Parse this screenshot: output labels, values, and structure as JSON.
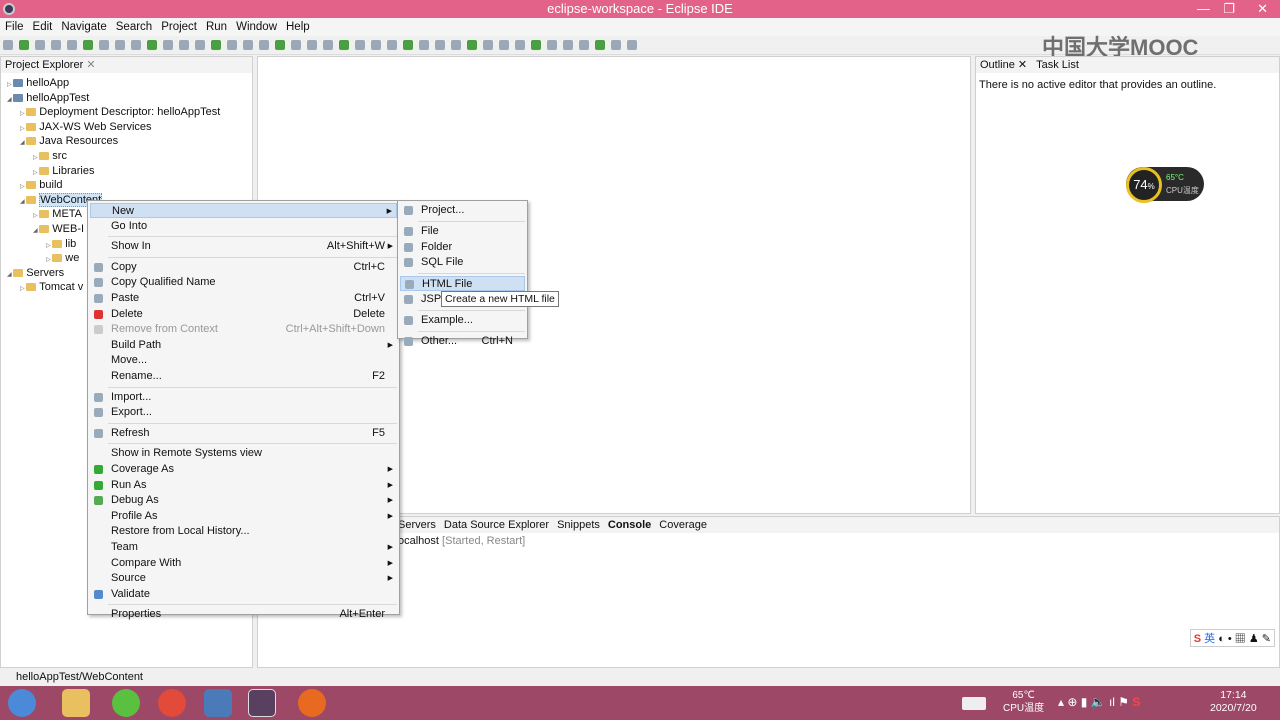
{
  "window": {
    "title": "eclipse-workspace - Eclipse IDE"
  },
  "menubar": [
    "File",
    "Edit",
    "Navigate",
    "Search",
    "Project",
    "Run",
    "Window",
    "Help"
  ],
  "watermark": "中国大学MOOC",
  "project_explorer": {
    "title": "Project Explorer",
    "items": [
      {
        "label": "helloApp",
        "level": 0,
        "icon": "project-icon"
      },
      {
        "label": "helloAppTest",
        "level": 0,
        "icon": "project-icon",
        "expanded": true
      },
      {
        "label": "Deployment Descriptor: helloAppTest",
        "level": 1,
        "icon": "descriptor-icon"
      },
      {
        "label": "JAX-WS Web Services",
        "level": 1,
        "icon": "webservice-icon"
      },
      {
        "label": "Java Resources",
        "level": 1,
        "icon": "folder-icon",
        "expanded": true
      },
      {
        "label": "src",
        "level": 2,
        "icon": "package-icon"
      },
      {
        "label": "Libraries",
        "level": 2,
        "icon": "library-icon"
      },
      {
        "label": "build",
        "level": 1,
        "icon": "folder-icon"
      },
      {
        "label": "WebContent",
        "level": 1,
        "icon": "folder-icon",
        "selected": true,
        "expanded": true
      },
      {
        "label": "META",
        "level": 2,
        "icon": "folder-icon"
      },
      {
        "label": "WEB-I",
        "level": 2,
        "icon": "folder-icon",
        "expanded": true
      },
      {
        "label": "lib",
        "level": 3,
        "icon": "folder-icon"
      },
      {
        "label": "we",
        "level": 3,
        "icon": "xml-file-icon"
      },
      {
        "label": "Servers",
        "level": 0,
        "icon": "folder-icon",
        "expanded": true
      },
      {
        "label": "Tomcat v",
        "level": 1,
        "icon": "folder-icon"
      }
    ]
  },
  "outline": {
    "tabs": [
      "Outline",
      "Task List"
    ],
    "message": "There is no active editor that provides an outline."
  },
  "cpu_widget": {
    "percent": "74",
    "unit": "%",
    "temp": "65°C",
    "label": "CPU温度"
  },
  "bottom_tabs": [
    "Servers",
    "Data Source Explorer",
    "Snippets",
    "Console",
    "Coverage"
  ],
  "console": {
    "server": "ocalhost",
    "status": "[Started, Restart]"
  },
  "context_menu": [
    {
      "label": "New",
      "submenu": true,
      "highlighted": true
    },
    {
      "label": "Go Into"
    },
    {
      "sep": true
    },
    {
      "label": "Show In",
      "shortcut": "Alt+Shift+W",
      "submenu": true
    },
    {
      "sep": true
    },
    {
      "label": "Copy",
      "shortcut": "Ctrl+C",
      "icon": "copy-icon"
    },
    {
      "label": "Copy Qualified Name",
      "icon": "copy-qualified-icon"
    },
    {
      "label": "Paste",
      "shortcut": "Ctrl+V",
      "icon": "paste-icon"
    },
    {
      "label": "Delete",
      "shortcut": "Delete",
      "icon": "delete-icon"
    },
    {
      "label": "Remove from Context",
      "shortcut": "Ctrl+Alt+Shift+Down",
      "disabled": true,
      "icon": "remove-context-icon"
    },
    {
      "label": "Build Path",
      "submenu": true
    },
    {
      "label": "Move..."
    },
    {
      "label": "Rename...",
      "shortcut": "F2"
    },
    {
      "sep": true
    },
    {
      "label": "Import...",
      "icon": "import-icon"
    },
    {
      "label": "Export...",
      "icon": "export-icon"
    },
    {
      "sep": true
    },
    {
      "label": "Refresh",
      "shortcut": "F5",
      "icon": "refresh-icon"
    },
    {
      "sep": true
    },
    {
      "label": "Show in Remote Systems view"
    },
    {
      "label": "Coverage As",
      "submenu": true,
      "icon": "coverage-icon"
    },
    {
      "label": "Run As",
      "submenu": true,
      "icon": "run-icon"
    },
    {
      "label": "Debug As",
      "submenu": true,
      "icon": "debug-icon"
    },
    {
      "label": "Profile As",
      "submenu": true
    },
    {
      "label": "Restore from Local History..."
    },
    {
      "label": "Team",
      "submenu": true
    },
    {
      "label": "Compare With",
      "submenu": true
    },
    {
      "label": "Source",
      "submenu": true
    },
    {
      "label": "Validate",
      "icon": "validate-icon"
    },
    {
      "sep": true
    },
    {
      "label": "Properties",
      "shortcut": "Alt+Enter"
    }
  ],
  "submenu": [
    {
      "label": "Project...",
      "icon": "project-wizard-icon"
    },
    {
      "sep": true
    },
    {
      "label": "File",
      "icon": "file-icon"
    },
    {
      "label": "Folder",
      "icon": "folder-icon"
    },
    {
      "label": "SQL File",
      "icon": "sql-file-icon"
    },
    {
      "sep": true
    },
    {
      "label": "HTML File",
      "icon": "html-file-icon",
      "highlighted": true
    },
    {
      "label": "JSP File",
      "icon": "jsp-file-icon"
    },
    {
      "sep": true
    },
    {
      "label": "Example...",
      "icon": "example-icon"
    },
    {
      "sep": true
    },
    {
      "label": "Other...",
      "shortcut": "Ctrl+N",
      "icon": "other-wizard-icon"
    }
  ],
  "tooltip": "Create a new HTML file",
  "statusbar": {
    "text": "helloAppTest/WebContent"
  },
  "taskbar": {
    "cpu_temp": "65℃",
    "cpu_label": "CPU温度",
    "time": "17:14",
    "date": "2020/7/20",
    "ime": "英"
  },
  "colors": {
    "titlebar": "#e2628a",
    "taskbar": "#9c4866",
    "highlight": "#cfe0f3"
  }
}
